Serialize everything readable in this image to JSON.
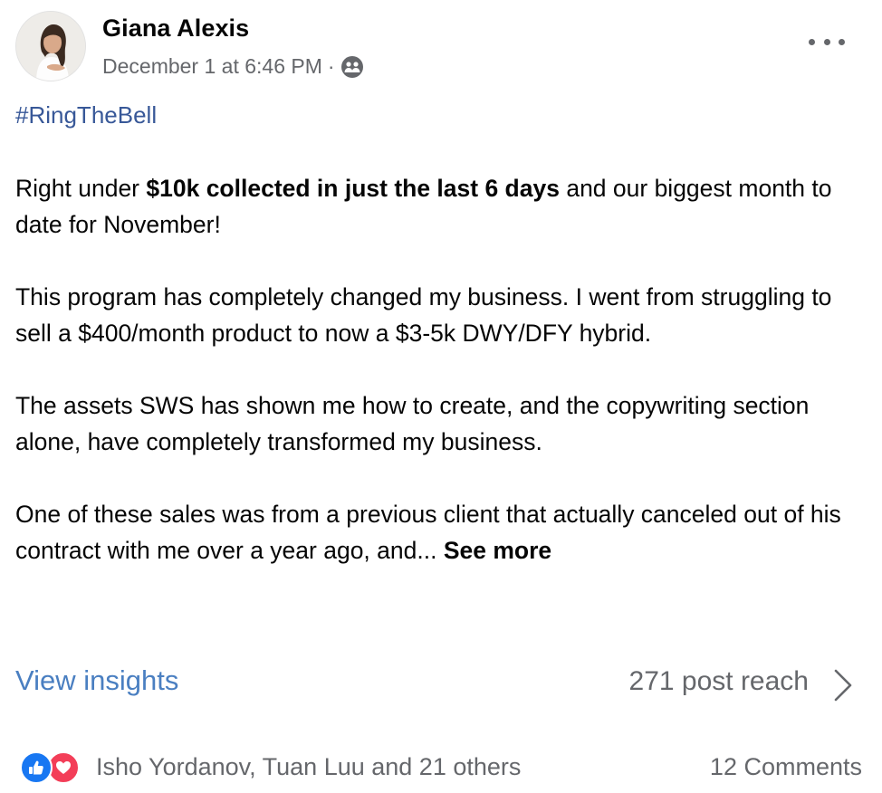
{
  "post": {
    "author": "Giana Alexis",
    "timestamp": "December 1 at 6:46 PM",
    "separator": "·",
    "audience_icon": "group-icon",
    "more_icon": "more-options-icon",
    "hashtag": "#RingTheBell",
    "paragraphs": [
      {
        "before": "Right under ",
        "bold": "$10k collected in just the last 6 days",
        "after": " and our biggest month to date for November!"
      },
      {
        "text": "This program has completely changed my business. I went from struggling to sell a $400/month product to now a $3-5k DWY/DFY hybrid."
      },
      {
        "text": "The assets SWS has shown me how to create, and the copywriting section alone, have completely transformed my business."
      },
      {
        "text": "One of these sales was from a previous client that actually canceled out of his contract with me over a year ago, and... ",
        "see_more": "See more"
      }
    ]
  },
  "insights": {
    "label": "View insights",
    "reach": "271 post reach"
  },
  "engagement": {
    "reactors": "Isho Yordanov, Tuan Luu and 21 others",
    "comments": "12 Comments",
    "like_color": "#1877f2",
    "love_color": "#f33e58"
  },
  "colors": {
    "link": "#385898",
    "insights_link": "#4a7fc1",
    "secondary_text": "#65676b",
    "primary_text": "#050505"
  }
}
